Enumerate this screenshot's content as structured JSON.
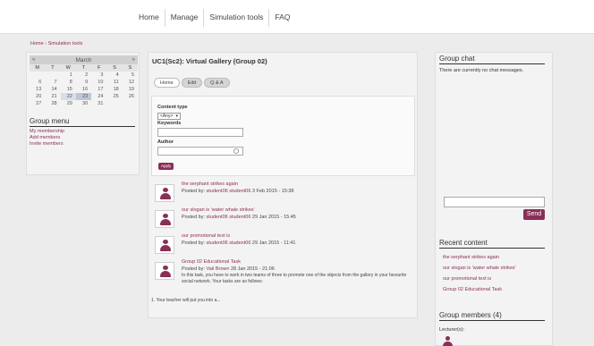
{
  "nav": {
    "items": [
      "Home",
      "Manage",
      "Simulation tools",
      "FAQ"
    ]
  },
  "breadcrumb": {
    "home": "Home",
    "sep": "›",
    "current": "Simulation tools"
  },
  "calendar": {
    "prev": "«",
    "next": "»",
    "month": "March",
    "dow": [
      "M",
      "T",
      "W",
      "T",
      "F",
      "S",
      "S"
    ],
    "weeks": [
      [
        "",
        "",
        "1",
        "2",
        "3",
        "4",
        "5"
      ],
      [
        "6",
        "7",
        "8",
        "9",
        "10",
        "11",
        "12"
      ],
      [
        "13",
        "14",
        "15",
        "16",
        "17",
        "18",
        "19"
      ],
      [
        "20",
        "21",
        "22",
        "23",
        "24",
        "25",
        "26"
      ],
      [
        "27",
        "28",
        "29",
        "30",
        "31",
        "",
        ""
      ]
    ],
    "today": "23",
    "highlight": "22"
  },
  "group_menu": {
    "title": "Group menu",
    "items": [
      "My membership",
      "Add members",
      "Invite members"
    ]
  },
  "main": {
    "title": "UC1(Sc2): Virtual Gallery (Group 02)",
    "tabs": [
      "Home",
      "Edit",
      "Q & A"
    ],
    "filter": {
      "content_type_label": "Content type",
      "content_type_value": "<Any>",
      "keywords_label": "Keywords",
      "author_label": "Author",
      "apply_label": "Apply"
    },
    "posts": [
      {
        "title": "the serphant strikes again",
        "posted_by": "Posted by:",
        "author": "student06 student06",
        "date": "3 Feb 2015 - 15:38",
        "desc": ""
      },
      {
        "title": "our slogan is 'water whale strikes'",
        "posted_by": "Posted by:",
        "author": "student06 student06",
        "date": "29 Jan 2015 - 15:45",
        "desc": ""
      },
      {
        "title": "our promotional text is",
        "posted_by": "Posted by:",
        "author": "student06 student06",
        "date": "29 Jan 2015 - 11:41",
        "desc": ""
      },
      {
        "title": "Group 02 Educational Task",
        "posted_by": "Posted by:",
        "author": "Vail Brown",
        "date": "28 Jan 2015 - 21:06",
        "desc": "In this task, you have to work in two teams of three to promote one of the objects from the gallery in your favourite social network. Your tasks are as follows:"
      }
    ],
    "footer_text": "1. Your teacher will put you into a..."
  },
  "chat": {
    "title": "Group chat",
    "empty_msg": "There are currently no chat messages.",
    "send_label": "Send"
  },
  "recent": {
    "title": "Recent content",
    "items": [
      "the serphant strikes again",
      "our slogan is 'water whale strikes'",
      "our promotional text is",
      "Group 02 Educational Task"
    ]
  },
  "members": {
    "title": "Group members (4)",
    "lecturer_label": "Lecturer(s):"
  },
  "colors": {
    "accent": "#8a2f57",
    "panel": "#f3f3f3",
    "bg": "#ececec"
  }
}
